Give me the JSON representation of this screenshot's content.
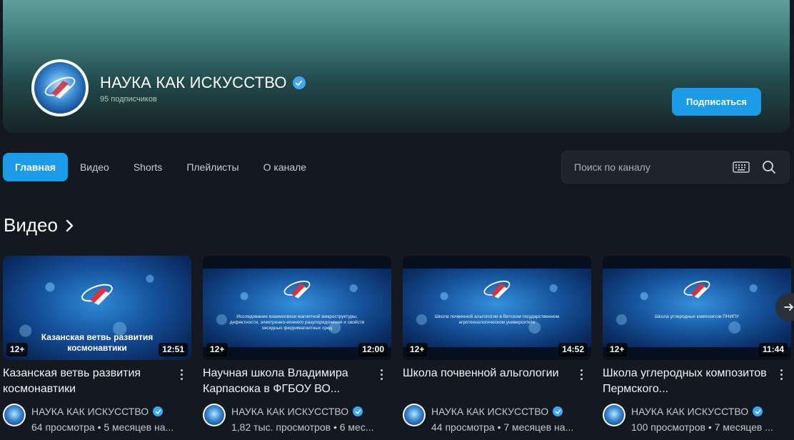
{
  "channel": {
    "name": "НАУКА КАК ИСКУССТВО",
    "subscribers": "95 подписчиков",
    "subscribe_label": "Подписаться"
  },
  "tabs": [
    {
      "label": "Главная",
      "active": true
    },
    {
      "label": "Видео",
      "active": false
    },
    {
      "label": "Shorts",
      "active": false
    },
    {
      "label": "Плейлисты",
      "active": false
    },
    {
      "label": "О канале",
      "active": false
    }
  ],
  "search": {
    "placeholder": "Поиск по каналу"
  },
  "section": {
    "title": "Видео"
  },
  "videos": [
    {
      "title": "Казанская ветвь развития космонавтики",
      "thumb_caption": "Казанская ветвь развития космонавтики",
      "age": "12+",
      "duration": "12:51",
      "channel": "НАУКА КАК ИСКУССТВО",
      "stats": "64 просмотра • 5 месяцев на..."
    },
    {
      "title": "Научная школа Владимира Карпасюка в ФГБОУ ВО...",
      "thumb_caption": "Исследование взаимосвязи магнитной микроструктуры, дефектности, электронно-ионного разупорядочения и свойств оксидных ферримагнитных сред",
      "age": "12+",
      "duration": "12:00",
      "channel": "НАУКА КАК ИСКУССТВО",
      "stats": "1,82 тыс. просмотров • 6 мес..."
    },
    {
      "title": "Школа почвенной альгологии",
      "thumb_caption": "Школа почвенной альгологии в Вятском государственном агротехнологическом университете",
      "age": "12+",
      "duration": "14:52",
      "channel": "НАУКА КАК ИСКУССТВО",
      "stats": "44 просмотра • 7 месяцев на..."
    },
    {
      "title": "Школа углеродных композитов Пермского...",
      "thumb_caption": "Школа углеродных композитов ПНИПУ",
      "age": "12+",
      "duration": "11:44",
      "channel": "НАУКА КАК ИСКУССТВО",
      "stats": "100 просмотров • 7 месяцев ..."
    }
  ],
  "colors": {
    "accent": "#1c9ce6",
    "verified": "#3ea6ff",
    "background": "#141820"
  },
  "icons": {
    "verified": "check-badge-icon",
    "keyboard": "keyboard-icon",
    "search": "search-icon",
    "chevron": "chevron-right-icon",
    "more": "kebab-menu-icon",
    "next": "arrow-right-icon"
  }
}
